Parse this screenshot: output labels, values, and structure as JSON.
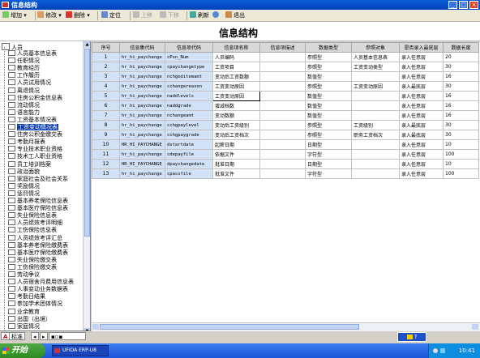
{
  "window": {
    "title": "信息结构",
    "min": "_",
    "max": "□",
    "close": "×"
  },
  "toolbar": {
    "add": "增加",
    "edit": "修改",
    "delete": "删除",
    "locate": "定位",
    "move_up": "上移",
    "move_down": "下移",
    "refresh": "刷新",
    "exit": "退出"
  },
  "page_title": "信息结构",
  "tree": {
    "root": "人员",
    "items": [
      "人员基本信息表",
      "任职情况",
      "教育经历",
      "工作履历",
      "人员试用情况",
      "离退情况",
      "住房公积金信息表",
      "流动情况",
      "语言能力",
      "工资基本情况表",
      "工资变动情况表",
      "住房公积金缴交表",
      "考勤月报表",
      "专业技术职业资格",
      "技术工人职业资格",
      "员工培训档案",
      "政治面貌",
      "家庭社会及社会关系",
      "奖励情况",
      "惩罚情况",
      "基本养老保险信息表",
      "基本医疗保险信息表",
      "失业保险信息表",
      "人员绩效考评明细",
      "工伤保险信息表",
      "人员绩效考评汇总",
      "基本养老保险缴费表",
      "基本医疗保险缴费表",
      "失业保险缴交表",
      "工伤保险缴交表",
      "劳动争议",
      "人员宿舍月费用信息表",
      "人事变动业务数据表",
      "考勤日结果",
      "参加学术团体情况",
      "业余教育",
      "出国（出境）",
      "家庭情况"
    ],
    "selected_index": 10,
    "tabs": [
      "标",
      "准"
    ]
  },
  "table": {
    "headers": [
      "序号",
      "信息集代码",
      "信息项代码",
      "信息项名称",
      "信息项描述",
      "数据类型",
      "参照对象",
      "是否录入最底层",
      "数据长度"
    ],
    "rows": [
      [
        "1",
        "hr_hi_paychange",
        "cPsn_Num",
        "人员编码",
        "",
        "参照型",
        "人员基本信息表",
        "录入任意层",
        "20"
      ],
      [
        "2",
        "hr_hi_paychange",
        "cpaychangetype",
        "工资项目",
        "",
        "参照型",
        "工资变动类型",
        "录入任意层",
        "30"
      ],
      [
        "3",
        "hr_hi_paychange",
        "nchgeditemamt",
        "变动后工资数额",
        "",
        "数值型",
        "",
        "录入任意层",
        "16"
      ],
      [
        "4",
        "hr_hi_paychange",
        "cchangereason",
        "工资变动原因",
        "",
        "参照型",
        "工资变动原因",
        "录入最底层",
        "30"
      ],
      [
        "5",
        "hr_hi_paychange",
        "naddlevels",
        "工资变动原因",
        "",
        "数值型",
        "",
        "录入任意层",
        "16"
      ],
      [
        "6",
        "hr_hi_paychange",
        "naddgrade",
        "增减档数",
        "",
        "数值型",
        "",
        "录入任意层",
        "16"
      ],
      [
        "7",
        "hr_hi_paychange",
        "nchangeamt",
        "变动数额",
        "",
        "数值型",
        "",
        "录入任意层",
        "16"
      ],
      [
        "8",
        "hr_hi_paychange",
        "cchgpaylevel",
        "变动后工资级别",
        "",
        "参照型",
        "工资级别",
        "录入最底层",
        "30"
      ],
      [
        "9",
        "hr_hi_paychange",
        "cchgpaygrade",
        "变动后工资档次",
        "",
        "参照型",
        "职务工资档次",
        "录入最底层",
        "30"
      ],
      [
        "10",
        "HR_HI_PAYCHANGE",
        "dstartdate",
        "起薪日期",
        "",
        "日期型",
        "",
        "录入任意层",
        "10"
      ],
      [
        "11",
        "hr_hi_paychange",
        "cdepayfile",
        "依据文件",
        "",
        "字符型",
        "",
        "录入任意层",
        "100"
      ],
      [
        "12",
        "HR_HI_PAYCHANGE",
        "dpaychangedate",
        "批准日期",
        "",
        "日期型",
        "",
        "录入任意层",
        "10"
      ],
      [
        "13",
        "hr_hi_paychange",
        "cpassfile",
        "批准文件",
        "",
        "字符型",
        "",
        "录入任意层",
        "100"
      ]
    ],
    "editing_cell": {
      "row": 4,
      "col": 3
    }
  },
  "status_help": "? ",
  "taskbar": {
    "start": "开始",
    "task": "UFIDA ERP-U8",
    "clock": "10:41"
  },
  "colors": {
    "accent": "#0a5fd8",
    "selected_tree": "#0a3cb0",
    "grid_blue": "#d2e2f6"
  }
}
